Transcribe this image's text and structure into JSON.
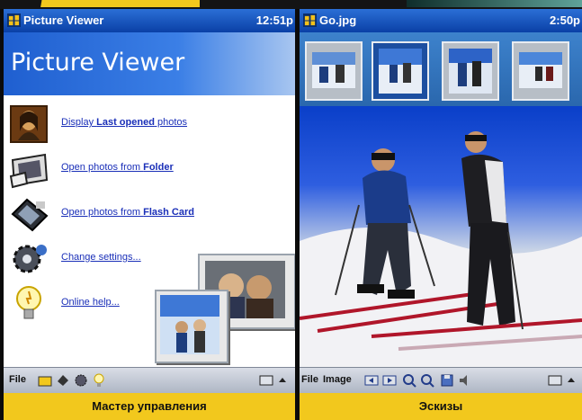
{
  "left_screen": {
    "title": "Picture Viewer",
    "time": "12:51p",
    "banner_title": "Picture Viewer",
    "menu": [
      {
        "icon": "mona-lisa-icon",
        "prefix": "Display ",
        "bold": "Last opened",
        "suffix": " photos"
      },
      {
        "icon": "folder-photos-icon",
        "prefix": "Open photos from ",
        "bold": "Folder",
        "suffix": ""
      },
      {
        "icon": "flash-card-icon",
        "prefix": "Open photos from ",
        "bold": "Flash Card",
        "suffix": ""
      },
      {
        "icon": "gear-settings-icon",
        "prefix": "Change settings...",
        "bold": "",
        "suffix": ""
      },
      {
        "icon": "lightbulb-icon",
        "prefix": "Online help...",
        "bold": "",
        "suffix": ""
      }
    ],
    "bottom_menu": "File",
    "caption": "Мастер управления"
  },
  "right_screen": {
    "title": "Go.jpg",
    "time": "2:50p",
    "bottom_menu_file": "File",
    "bottom_menu_image": "Image",
    "caption": "Эскизы"
  },
  "colors": {
    "caption_bg": "#f2c81d",
    "titlebar": "#0a40a6",
    "link": "#1a2fb8"
  }
}
